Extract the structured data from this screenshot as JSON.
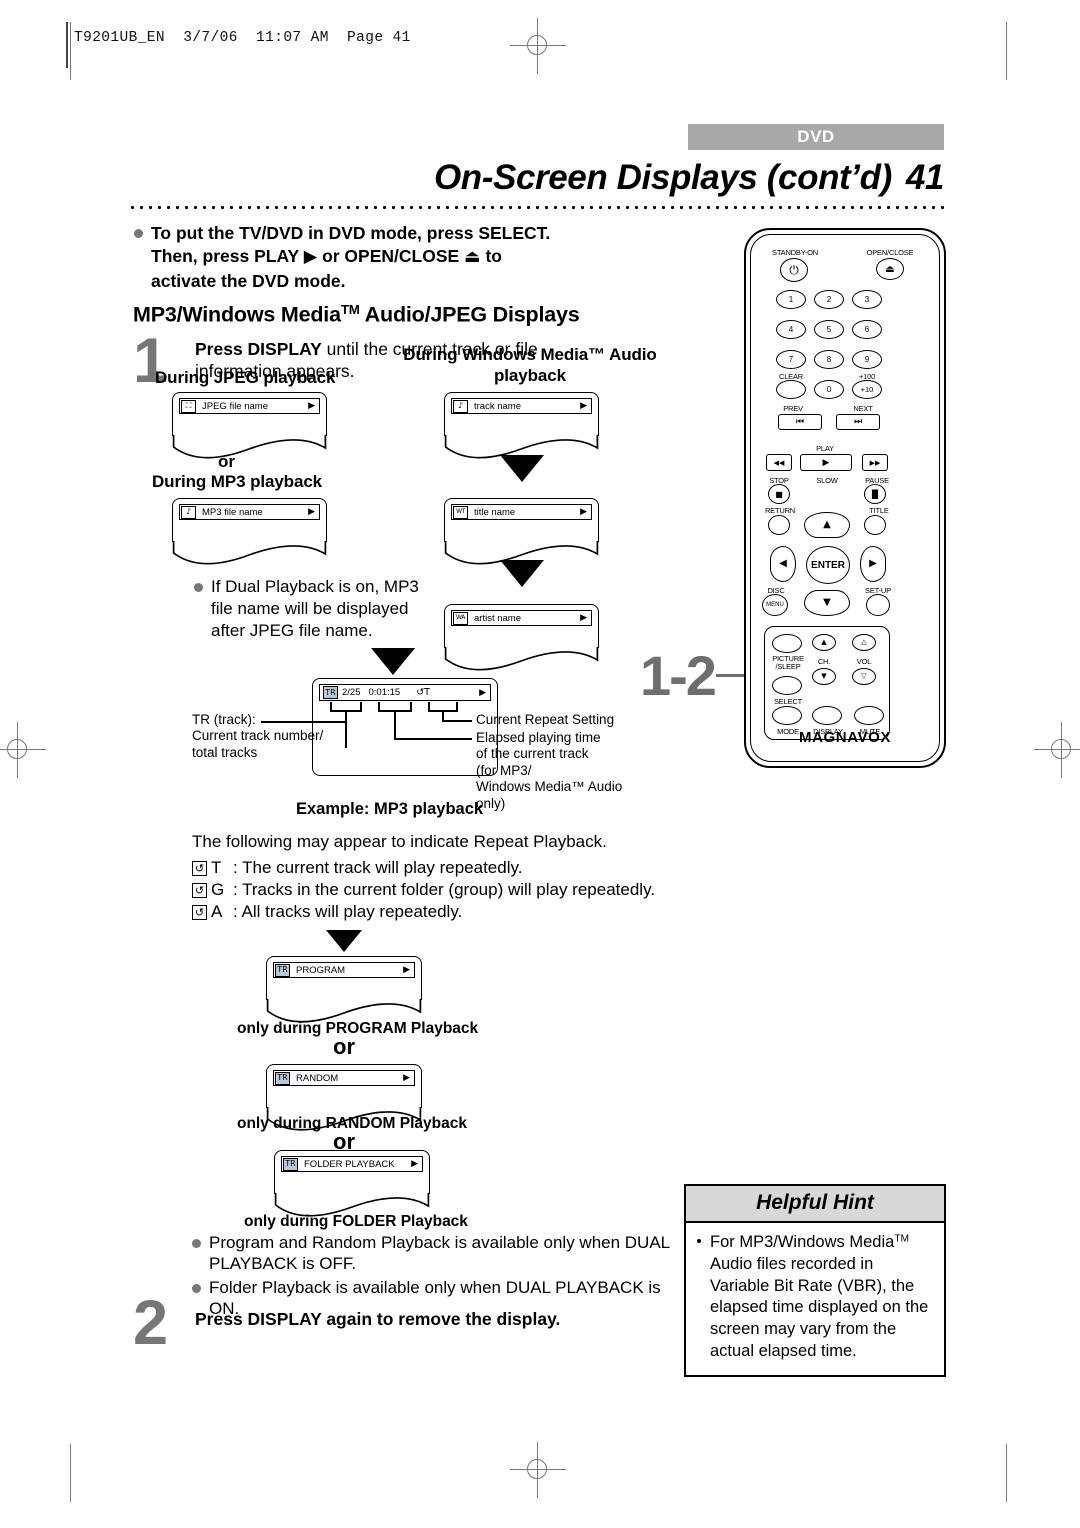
{
  "file_header": "T9201UB_EN  3/7/06  11:07 AM  Page 41",
  "header": {
    "tag": "DVD",
    "title": "On-Screen Displays (cont’d)",
    "page_number": "41"
  },
  "note": {
    "line1": "To put the TV/DVD in DVD mode, press SELECT.",
    "line2_a": "Then, press PLAY",
    "line2_play_icon": "▶",
    "line2_b": "or OPEN/CLOSE",
    "line2_eject_icon": "⏏",
    "line2_c": "to",
    "line3": "activate the DVD mode."
  },
  "section_title": {
    "before": "MP3/Windows Media",
    "tm": "TM",
    "after": " Audio/JPEG Displays"
  },
  "step1": {
    "number": "1",
    "bold": "Press DISPLAY",
    "rest": " until the current track or file",
    "line2": "information appears."
  },
  "labels": {
    "during_jpeg": "During JPEG playback",
    "during_wma_line1": "During Windows Media™ Audio",
    "during_wma_line2": "playback",
    "or_small": "or",
    "during_mp3": "During MP3 playback",
    "example": "Example: MP3 playback"
  },
  "osd_panels": {
    "jpeg": {
      "icon": "⛶",
      "text": "JPEG file name",
      "play": "▶"
    },
    "mp3": {
      "icon": "♪",
      "text": "MP3 file name",
      "play": "▶"
    },
    "track": {
      "icon": "♪",
      "text": "track name",
      "play": "▶"
    },
    "title": {
      "icon": "WT",
      "text": "title name",
      "play": "▶"
    },
    "artist": {
      "icon": "WA",
      "text": "artist name",
      "play": "▶"
    }
  },
  "dual_note": {
    "line1": "If Dual Playback is on, MP3",
    "line2": "file name will be displayed",
    "line3": "after JPEG file name."
  },
  "status_bar": {
    "icon": "TR",
    "track": "2/25",
    "time": "0:01:15",
    "repeat": "↺T",
    "play": "▶"
  },
  "callouts": {
    "left_line1": "TR (track):",
    "left_line2": "Current track number/",
    "left_line3": "total tracks",
    "right_repeat": "Current Repeat Setting",
    "right_elapsed_1": "Elapsed playing time",
    "right_elapsed_2": "of the current track",
    "right_elapsed_3": "(for MP3/",
    "right_elapsed_4": "Windows Media™ Audio",
    "right_elapsed_5": "only)"
  },
  "repeat_legend": {
    "intro": "The following may appear to indicate Repeat Playback.",
    "rows": [
      {
        "icon": "↺",
        "letter": "T",
        "text": ": The current track will play repeatedly."
      },
      {
        "icon": "↺",
        "letter": "G",
        "text": ": Tracks in the current folder (group) will play repeatedly."
      },
      {
        "icon": "↺",
        "letter": "A",
        "text": ": All tracks will play repeatedly."
      }
    ]
  },
  "mode_panels": [
    {
      "icon": "TR",
      "text": "PROGRAM",
      "play": "▶",
      "caption": "only during PROGRAM Playback"
    },
    {
      "icon": "TR",
      "text": "RANDOM",
      "play": "▶",
      "caption": "only during RANDOM Playback"
    },
    {
      "icon": "TR",
      "text": "FOLDER PLAYBACK",
      "play": "▶",
      "caption": "only during FOLDER Playback"
    }
  ],
  "or_big": "or",
  "closing_bullets": [
    "Program and Random Playback is available only when DUAL PLAYBACK is OFF.",
    "Folder Playback is available only when DUAL PLAYBACK is ON."
  ],
  "step2": {
    "number": "2",
    "text": "Press DISPLAY again to remove the display."
  },
  "hint": {
    "title": "Helpful Hint",
    "body_before": "For MP3/Windows Media",
    "body_tm": "TM",
    "body_after": " Audio files recorded in Variable Bit Rate (VBR), the elapsed time displayed on the screen may vary from the actual elapsed time."
  },
  "remote_callout": "1-2",
  "remote": {
    "brand": "MAGNAVOX",
    "standby_label": "STANDBY-ON",
    "open_close_label": "OPEN/CLOSE",
    "power_icon": "⏻",
    "eject_icon": "⏏",
    "numbers": [
      "1",
      "2",
      "3",
      "4",
      "5",
      "6",
      "7",
      "8",
      "9",
      "0"
    ],
    "clear_label": "CLEAR",
    "plus100_label": "+100",
    "plus10_label": "+10",
    "prev_label": "PREV",
    "next_label": "NEXT",
    "prev_icon": "⏮",
    "next_icon": "⏭",
    "play_label": "PLAY",
    "play_icon": "▶",
    "rew_icon": "◀◀",
    "ff_icon": "▶▶",
    "stop_label": "STOP",
    "slow_label": "SLOW",
    "pause_label": "PAUSE",
    "stop_icon": "■",
    "pause_icon": "▐▌",
    "return_label": "RETURN",
    "title_label": "TITLE",
    "enter_label": "ENTER",
    "up_icon": "▲",
    "down_icon": "▼",
    "left_icon": "◀",
    "right_icon": "▶",
    "disc_label": "DISC",
    "disc_sub": "MENU",
    "setup_label": "SET-UP",
    "picture_label_1": "PICTURE",
    "picture_label_2": "/SLEEP",
    "ch_label": "CH.",
    "vol_label": "VOL",
    "select_label": "SELECT",
    "mode_label": "MODE",
    "display_label": "DISPLAY",
    "mute_label": "MUTE",
    "vol_up_icon": "△",
    "vol_down_icon": "▽"
  }
}
